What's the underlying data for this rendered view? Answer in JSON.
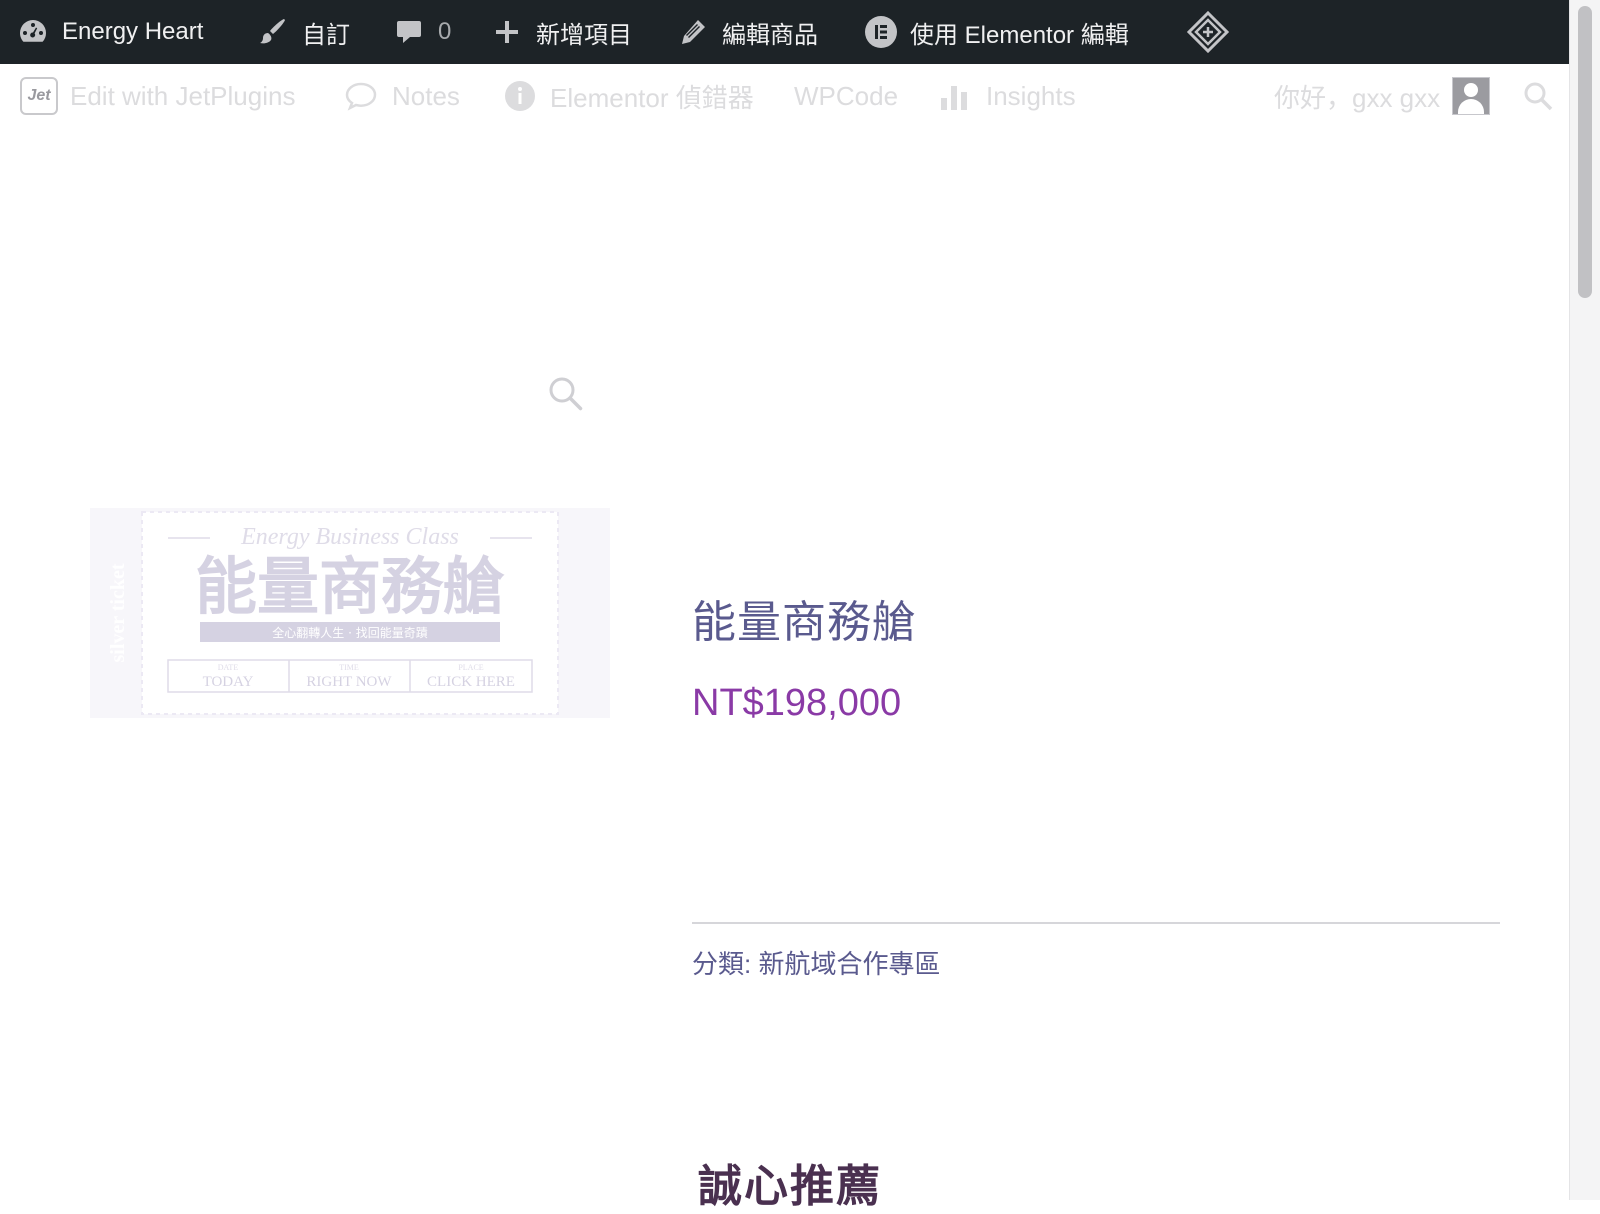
{
  "adminbar": {
    "site_name": "Energy Heart",
    "customize": "自訂",
    "comments_count": "0",
    "new_item": "新增項目",
    "edit_product": "編輯商品",
    "edit_elementor": "使用 Elementor 編輯"
  },
  "toolbar": {
    "jet_logo": "Jet",
    "edit_jetplugins": "Edit with JetPlugins",
    "notes": "Notes",
    "elementor_debugger": "Elementor 偵錯器",
    "wpcode": "WPCode",
    "insights": "Insights",
    "greeting": "你好，gxx gxx"
  },
  "ticket": {
    "script_title": "Energy Business Class",
    "title": "能量商務艙",
    "banner": "全心翻轉人生 · 找回能量奇蹟",
    "side_left": "silver ticket",
    "cols": [
      {
        "small": "DATE",
        "big": "TODAY"
      },
      {
        "small": "TIME",
        "big": "RIGHT NOW"
      },
      {
        "small": "PLACE",
        "big": "CLICK HERE"
      }
    ]
  },
  "product": {
    "title": "能量商務艙",
    "price": "NT$198,000",
    "category_label": "分類:",
    "category_value": "新航域合作專區"
  },
  "recommend": {
    "heading": "誠心推薦"
  },
  "colors": {
    "adminbar_bg": "#1d2327",
    "title": "#5a5a8e",
    "price": "#8a3aa6",
    "heading": "#4a3050"
  }
}
